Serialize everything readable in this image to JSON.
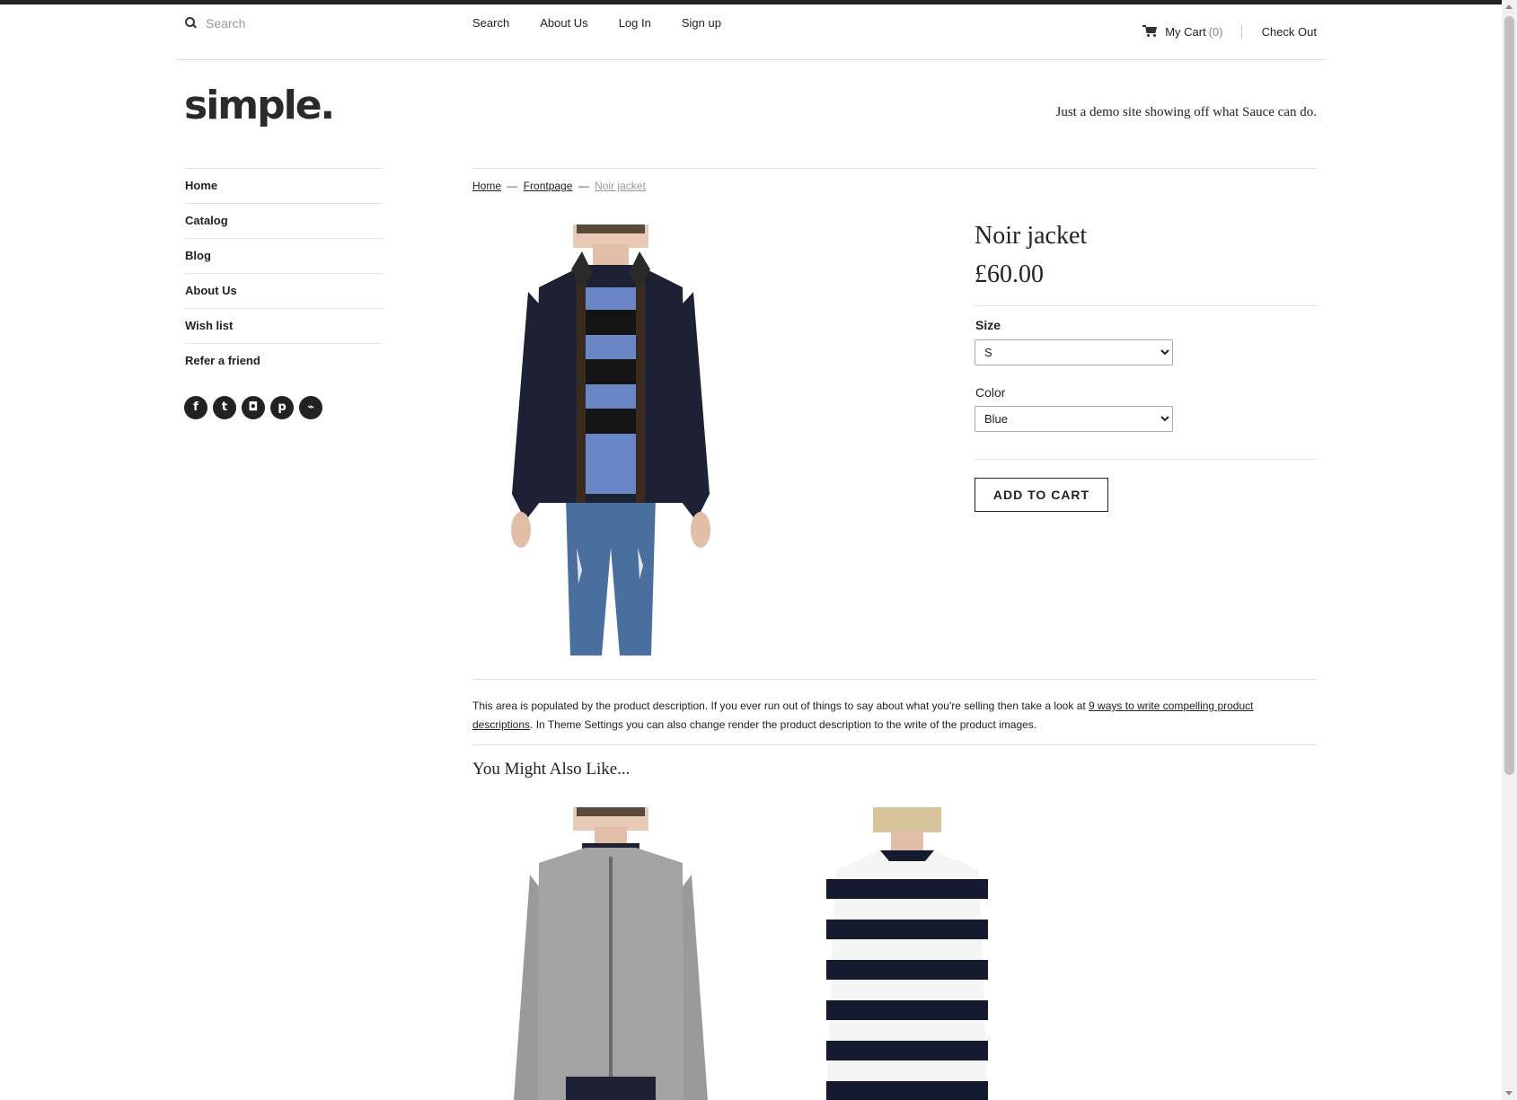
{
  "search": {
    "placeholder": "Search"
  },
  "top_nav": [
    {
      "label": "Search"
    },
    {
      "label": "About Us"
    },
    {
      "label": "Log In"
    },
    {
      "label": "Sign up"
    }
  ],
  "cart": {
    "label": "My Cart",
    "count": "(0)",
    "checkout_label": "Check Out"
  },
  "logo": "simple.",
  "tagline": "Just a demo site showing off what Sauce can do.",
  "sidebar": {
    "items": [
      {
        "label": "Home"
      },
      {
        "label": "Catalog"
      },
      {
        "label": "Blog"
      },
      {
        "label": "About Us"
      },
      {
        "label": "Wish list"
      },
      {
        "label": "Refer a friend"
      }
    ],
    "social": [
      {
        "icon": "facebook-icon",
        "glyph": "f"
      },
      {
        "icon": "twitter-icon",
        "glyph": "t"
      },
      {
        "icon": "instagram-icon",
        "glyph": "◘"
      },
      {
        "icon": "pinterest-icon",
        "glyph": "p"
      },
      {
        "icon": "rss-icon",
        "glyph": "⌁"
      }
    ]
  },
  "breadcrumb": {
    "home": "Home",
    "sep": "—",
    "frontpage": "Frontpage",
    "current": "Noir jacket"
  },
  "product": {
    "title": "Noir jacket",
    "price": "£60.00",
    "size_label": "Size",
    "size_value": "S",
    "color_label": "Color",
    "color_value": "Blue",
    "add_to_cart": "ADD TO CART"
  },
  "description": {
    "before": "This area is populated by the product description. If you ever run out of things to say about what you're selling then take a look at ",
    "link": "9 ways to write compelling product descriptions",
    "after": ". In Theme Settings you can also change render the product description to the write of the product images."
  },
  "related": {
    "title": "You Might Also Like..."
  },
  "colors": {
    "jacket": "#1c2233",
    "stripe_blue": "#6b86c4",
    "denim": "#4a6f9e",
    "grey": "#9a9a9a"
  }
}
